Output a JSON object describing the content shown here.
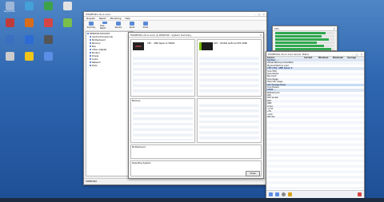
{
  "desktop_icons": [
    {
      "label": "Recycle Bin",
      "color": "#9fb7d6"
    },
    {
      "label": "",
      "color": "#c03b3b"
    },
    {
      "label": "",
      "color": "#3b6fc0"
    },
    {
      "label": "",
      "color": "#ccc",
      "dark": true
    },
    {
      "label": "",
      "color": "#44a0d8"
    },
    {
      "label": "",
      "color": "#d86c1a"
    },
    {
      "label": "",
      "color": "#2d6bd4"
    },
    {
      "label": "",
      "color": "#f0c419"
    },
    {
      "label": "",
      "color": "#3ea24a"
    },
    {
      "label": "",
      "color": "#d64545"
    },
    {
      "label": "",
      "color": "#555"
    },
    {
      "label": "",
      "color": "#5b8ee6"
    },
    {
      "label": "",
      "color": "#e3e3e3"
    },
    {
      "label": "",
      "color": "#7abf4a"
    }
  ],
  "hwinfo_main": {
    "title": "HWiNFO64 v6.xx-xxxx",
    "menu": [
      "Program",
      "Report",
      "Monitoring",
      "Help"
    ],
    "toolbar": [
      {
        "label": "Summary"
      },
      {
        "label": "Save Report"
      },
      {
        "label": "Sensors"
      },
      {
        "label": "About"
      },
      {
        "label": "Driver"
      }
    ],
    "tree": [
      "DESKTOP-XXXXXXX",
      "Central Processor(s)",
      "Motherboard",
      "Memory",
      "Bus",
      "Video Adapter",
      "Monitor",
      "Drives",
      "Audio",
      "Network",
      "Ports"
    ],
    "status": "HWiNFO64"
  },
  "summary": {
    "title": "HWiNFO64 v6.xx-xxxx @ DESKTOP - System Summary",
    "cpu_label": "CPU",
    "cpu_name": "AMD Ryzen 9 3900X",
    "gpu_label": "GPU",
    "gpu_name": "NVIDIA GeForce RTX 2080",
    "memory_label": "Memory",
    "mb_label": "Motherboard",
    "os_label": "Operating System",
    "close": "Close"
  },
  "sensors": {
    "title": "HWiNFO64 v6.xx-xxxx Sensor Status",
    "columns": [
      "Sensor",
      "Current",
      "Minimum",
      "Maximum",
      "Average"
    ],
    "rows": [
      {
        "type": "sec",
        "cells": [
          "System: ...",
          "",
          "",
          "",
          ""
        ]
      },
      {
        "cells": [
          "Virtual Memory Committed",
          "",
          "",
          "",
          ""
        ]
      },
      {
        "cells": [
          "Physical Memory Load",
          "",
          "",
          "",
          ""
        ]
      },
      {
        "type": "sec",
        "cells": [
          "CPU [#0]: AMD Ryzen 9",
          "",
          "",
          "",
          ""
        ]
      },
      {
        "cells": [
          "Core VIDs",
          "",
          "",
          "",
          ""
        ]
      },
      {
        "cells": [
          "Core Clocks",
          "",
          "",
          "",
          ""
        ]
      },
      {
        "cells": [
          "Bus Clock",
          "",
          "",
          "",
          ""
        ]
      },
      {
        "cells": [
          "Core Usage",
          "",
          "",
          "",
          ""
        ]
      },
      {
        "cells": [
          "Total CPU Usage",
          "",
          "",
          "",
          ""
        ]
      },
      {
        "type": "sel",
        "cells": [
          "CPU Package Power",
          "",
          "",
          "",
          ""
        ]
      },
      {
        "cells": [
          "Core Powers",
          "",
          "",
          "",
          ""
        ]
      },
      {
        "type": "sec",
        "cells": [
          "ASUS ...",
          "",
          "",
          "",
          ""
        ]
      },
      {
        "cells": [
          "Motherboard",
          "",
          "",
          "",
          ""
        ]
      },
      {
        "cells": [
          "CPU",
          "",
          "",
          "",
          ""
        ]
      },
      {
        "cells": [
          "CPU Socket",
          "",
          "",
          "",
          ""
        ]
      },
      {
        "cells": [
          "PCH",
          "",
          "",
          "",
          ""
        ]
      },
      {
        "cells": [
          "VRM",
          "",
          "",
          "",
          ""
        ]
      },
      {
        "cells": [
          "Vcore",
          "",
          "",
          "",
          ""
        ]
      },
      {
        "cells": [
          "+3.3V",
          "",
          "",
          "",
          ""
        ]
      },
      {
        "cells": [
          "+5V",
          "",
          "",
          "",
          ""
        ]
      },
      {
        "cells": [
          "+12V",
          "",
          "",
          "",
          ""
        ]
      },
      {
        "cells": [
          "CPU Fan",
          "",
          "",
          "",
          ""
        ]
      }
    ]
  },
  "mini_graph": {
    "title": "CPU",
    "bars": [
      {
        "fill": 0.85
      },
      {
        "fill": 0.78
      },
      {
        "fill": 0.9
      },
      {
        "fill": 0.7
      },
      {
        "fill": 0.82
      },
      {
        "fill": 0.95
      }
    ]
  }
}
